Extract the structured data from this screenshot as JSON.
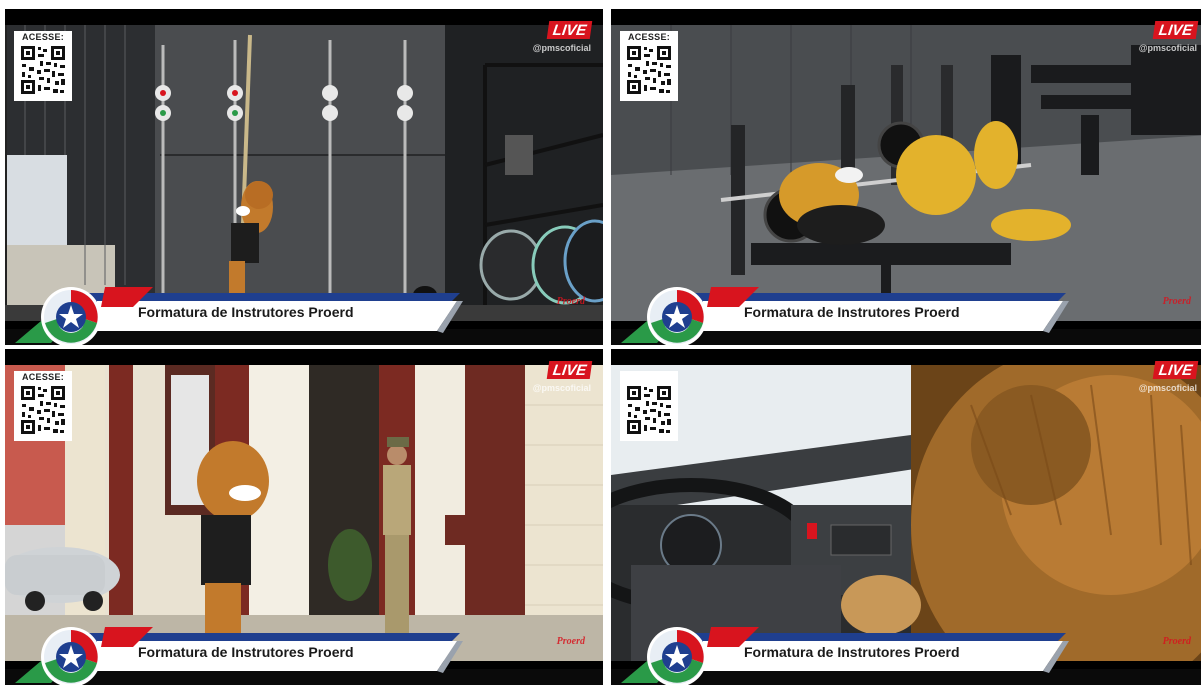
{
  "panels": [
    {
      "id": "gym-rope",
      "qr_label": "ACESSE:",
      "live_badge": "LIVE",
      "handle": "@pmscoficial",
      "banner_title": "Formatura de Instrutores Proerd",
      "watermark": "Proerd"
    },
    {
      "id": "gym-bench",
      "qr_label": "ACESSE:",
      "live_badge": "LIVE",
      "handle": "@pmscoficial",
      "banner_title": "Formatura de Instrutores Proerd",
      "watermark": "Proerd"
    },
    {
      "id": "street-door",
      "qr_label": "ACESSE:",
      "live_badge": "LIVE",
      "handle": "@pmscoficial",
      "banner_title": "Formatura de Instrutores Proerd",
      "watermark": "Proerd"
    },
    {
      "id": "car-interior",
      "qr_label": "",
      "live_badge": "LIVE",
      "handle": "@pmscoficial",
      "banner_title": "Formatura de Instrutores Proerd",
      "watermark": "Proerd"
    }
  ],
  "colors": {
    "live_red": "#d8141e",
    "banner_blue": "#1f3f8f",
    "banner_red": "#d8141e",
    "logo_green": "#2a9a48"
  },
  "icons": [
    "qr-code-icon",
    "state-star-logo-icon"
  ]
}
